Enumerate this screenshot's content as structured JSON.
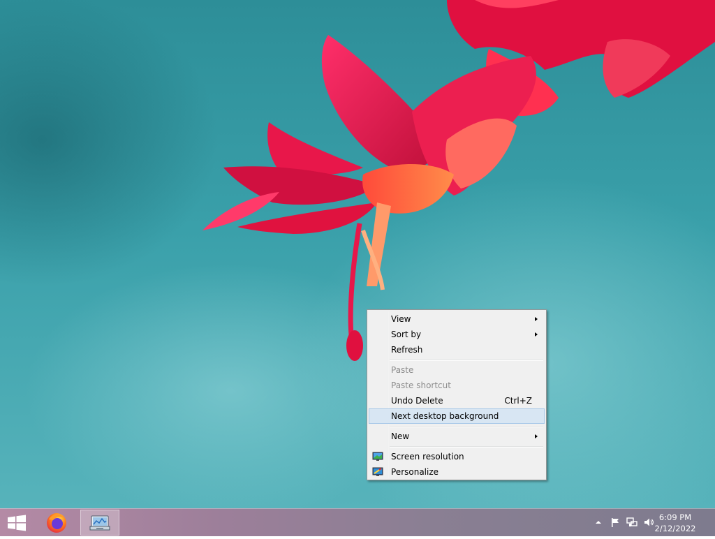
{
  "context_menu": {
    "items": [
      {
        "label": "View",
        "has_submenu": true
      },
      {
        "label": "Sort by",
        "has_submenu": true
      },
      {
        "label": "Refresh"
      },
      {
        "label": "Paste",
        "disabled": true
      },
      {
        "label": "Paste shortcut",
        "disabled": true
      },
      {
        "label": "Undo Delete",
        "shortcut": "Ctrl+Z"
      },
      {
        "label": "Next desktop background",
        "highlighted": true
      },
      {
        "label": "New",
        "has_submenu": true
      },
      {
        "label": "Screen resolution",
        "icon": "screen-resolution-icon"
      },
      {
        "label": "Personalize",
        "icon": "personalize-icon"
      }
    ]
  },
  "taskbar": {
    "start_icon": "windows-logo-icon",
    "pinned": [
      {
        "name": "firefox",
        "icon": "firefox-icon"
      },
      {
        "name": "control-panel",
        "icon": "control-panel-icon",
        "active": true
      }
    ],
    "tray_icons": [
      "show-hidden-icons-icon",
      "action-center-flag-icon",
      "network-icon",
      "volume-icon"
    ],
    "clock": {
      "time": "6:09 PM",
      "date": "2/12/2022"
    }
  },
  "colors": {
    "menu_bg": "#f0f0f0",
    "menu_highlight": "#d8e6f3",
    "disabled_text": "#8d8d8d",
    "desktop_teal": "#3aa0aa",
    "flower_red": "#e8174a"
  }
}
